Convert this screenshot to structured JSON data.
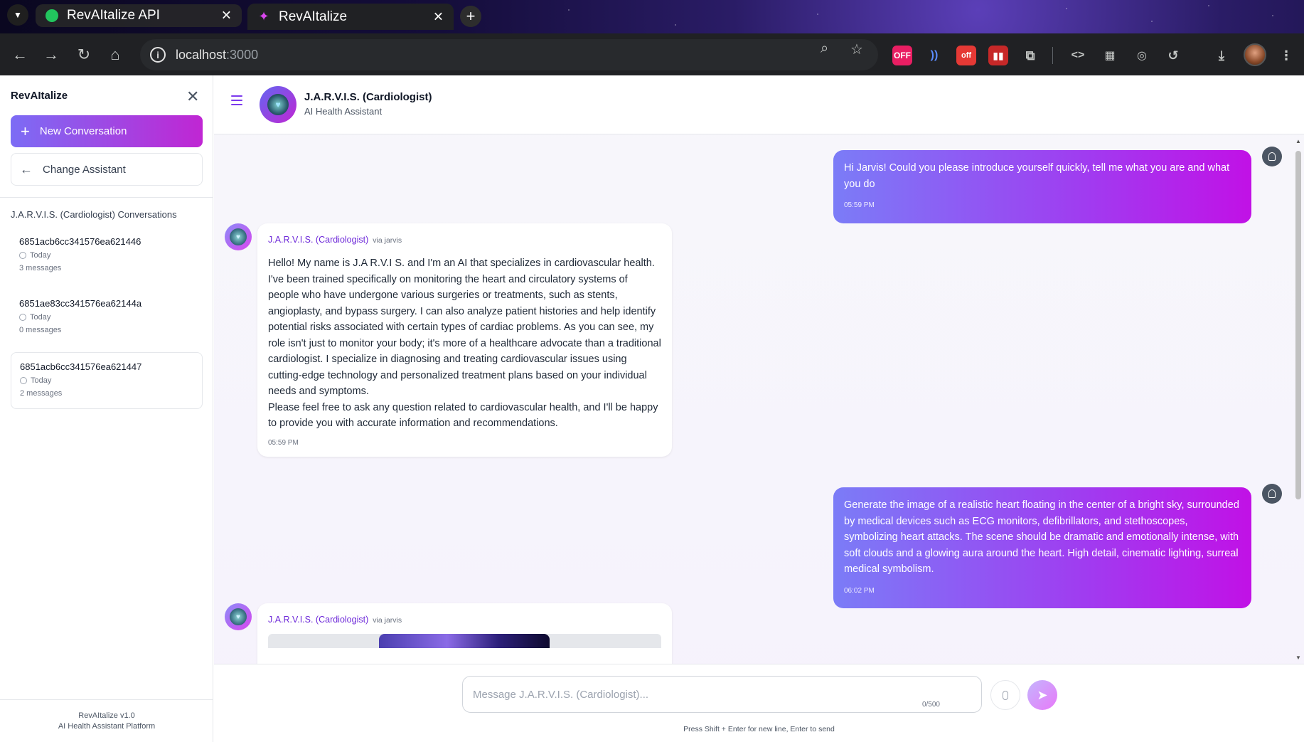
{
  "browser": {
    "tabs": [
      {
        "title": "RevAItalize API",
        "active": false
      },
      {
        "title": "RevAItalize",
        "active": true
      }
    ],
    "url_host": "localhost",
    "url_port": ":3000",
    "extensions": {
      "ext1_label": "OFF",
      "ext2_label": "off"
    }
  },
  "sidebar": {
    "title": "RevAItalize",
    "new_conversation": "New Conversation",
    "change_assistant": "Change Assistant",
    "conversations_heading": "J.A.R.V.I.S. (Cardiologist) Conversations",
    "conversations": [
      {
        "id": "6851acb6cc341576ea621446",
        "when": "Today",
        "count": "3 messages"
      },
      {
        "id": "6851ae83cc341576ea62144a",
        "when": "Today",
        "count": "0 messages"
      },
      {
        "id": "6851acb6cc341576ea621447",
        "when": "Today",
        "count": "2 messages"
      }
    ],
    "footer_version": "RevAItalize v1.0",
    "footer_tagline": "AI Health Assistant Platform"
  },
  "header": {
    "assistant_name": "J.A.R.V.I.S. (Cardiologist)",
    "assistant_role": "AI Health Assistant"
  },
  "messages": [
    {
      "role": "user",
      "text": "Hi Jarvis! Could you please introduce yourself quickly, tell me what you are and what you do",
      "time": "05:59 PM"
    },
    {
      "role": "assistant",
      "sender": "J.A.R.V.I.S. (Cardiologist)",
      "via": "via jarvis",
      "text": "Hello! My name is J.A R.V.I S. and I'm an AI that specializes in cardiovascular health. I've been trained specifically on monitoring the heart and circulatory systems of people who have undergone various surgeries or treatments, such as stents, angioplasty, and bypass surgery. I can also analyze patient histories and help identify potential risks associated with certain types of cardiac problems. As you can see, my role isn't just to monitor your body; it's more of a healthcare advocate than a traditional cardiologist. I specialize in diagnosing and treating cardiovascular issues using cutting-edge technology and personalized treatment plans based on your individual needs and symptoms.\nPlease feel free to ask any question related to cardiovascular health, and I'll be happy to provide you with accurate information and recommendations.",
      "time": "05:59 PM"
    },
    {
      "role": "user",
      "text": "Generate the image of a realistic heart floating in the center of a bright sky, surrounded by medical devices such as ECG monitors, defibrillators, and stethoscopes, symbolizing heart attacks. The scene should be dramatic and emotionally intense, with soft clouds and a glowing aura around the heart. High detail, cinematic lighting, surreal medical symbolism.",
      "time": "06:02 PM"
    },
    {
      "role": "assistant",
      "sender": "J.A.R.V.I.S. (Cardiologist)",
      "via": "via jarvis"
    }
  ],
  "composer": {
    "placeholder": "Message J.A.R.V.I.S. (Cardiologist)...",
    "counter": "0/500",
    "hint": "Press Shift + Enter for new line, Enter to send"
  }
}
